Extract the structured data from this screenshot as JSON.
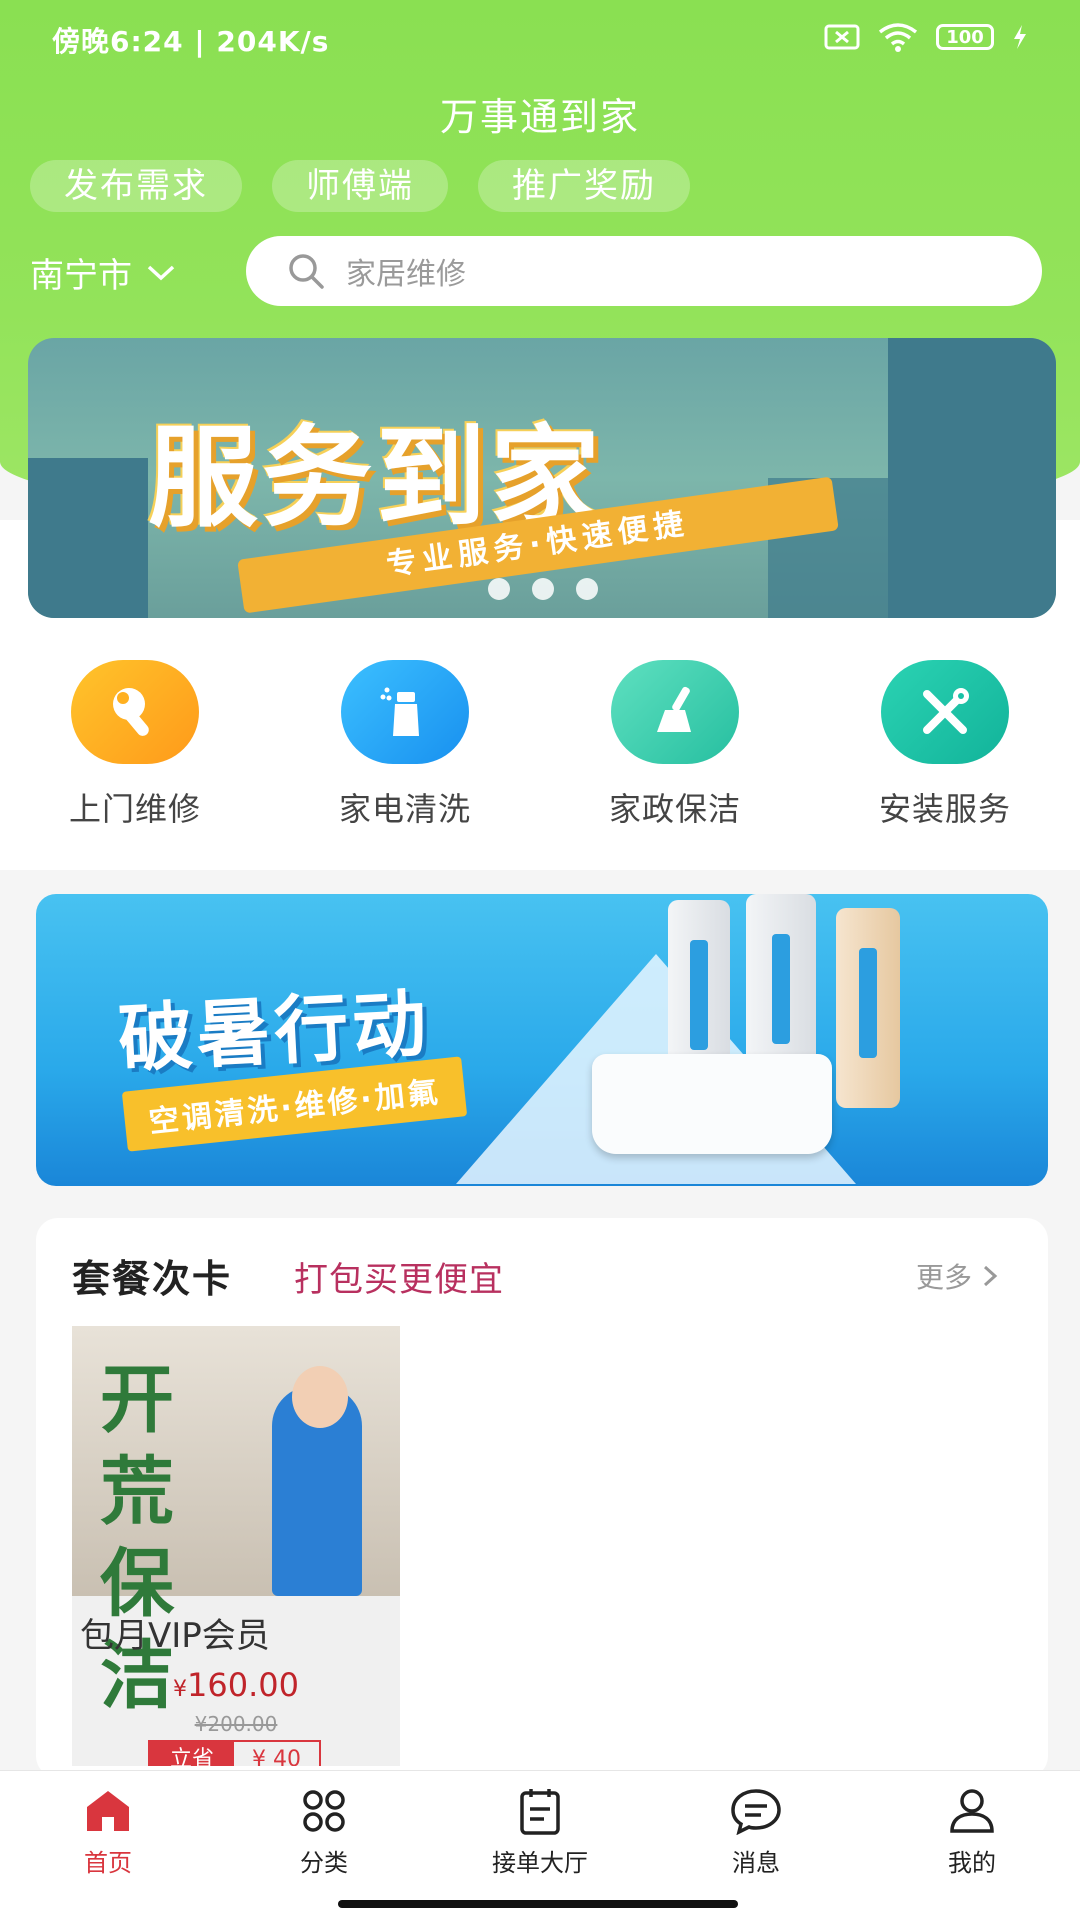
{
  "status_bar": {
    "time_speed": "傍晚6:24 | 204K/s",
    "battery": "100",
    "icons": [
      "mute-bell-icon",
      "android-icon",
      "sim-off-icon",
      "wifi-icon",
      "battery-icon",
      "charging-icon"
    ]
  },
  "app_title": "万事通到家",
  "quick_links": [
    "发布需求",
    "师傅端",
    "推广奖励"
  ],
  "location": {
    "city": "南宁市"
  },
  "search": {
    "placeholder": "家居维修"
  },
  "banner": {
    "title": "服务到家",
    "subtitle": "专业服务·快速便捷",
    "page_count": 3
  },
  "categories": [
    {
      "label": "上门维修",
      "icon": "wrench-icon",
      "color": "#ffa31a"
    },
    {
      "label": "家电清洗",
      "icon": "spray-bottle-icon",
      "color": "#1fa6f2"
    },
    {
      "label": "家政保洁",
      "icon": "broom-icon",
      "color": "#3dcfb2"
    },
    {
      "label": "安装服务",
      "icon": "tools-icon",
      "color": "#19c2a6"
    }
  ],
  "promo": {
    "title": "破暑行动",
    "subtitle": "空调清洗·维修·加氟"
  },
  "packages": {
    "title": "套餐次卡",
    "subtitle": "打包买更便宜",
    "more": "更多",
    "items": [
      {
        "image_text": "开荒保洁",
        "name": "包月VIP会员",
        "currency": "¥",
        "price": "160.00",
        "original_price": "¥200.00",
        "save_label": "立省",
        "save_amount": "¥ 40"
      }
    ]
  },
  "tabbar": [
    {
      "label": "首页",
      "icon": "home-icon",
      "active": true
    },
    {
      "label": "分类",
      "icon": "grid-icon",
      "active": false
    },
    {
      "label": "接单大厅",
      "icon": "clipboard-icon",
      "active": false
    },
    {
      "label": "消息",
      "icon": "chat-icon",
      "active": false
    },
    {
      "label": "我的",
      "icon": "user-icon",
      "active": false
    }
  ],
  "colors": {
    "header_green": "#8ae052",
    "accent_red": "#d9363e",
    "subtitle_red": "#b8305f"
  }
}
